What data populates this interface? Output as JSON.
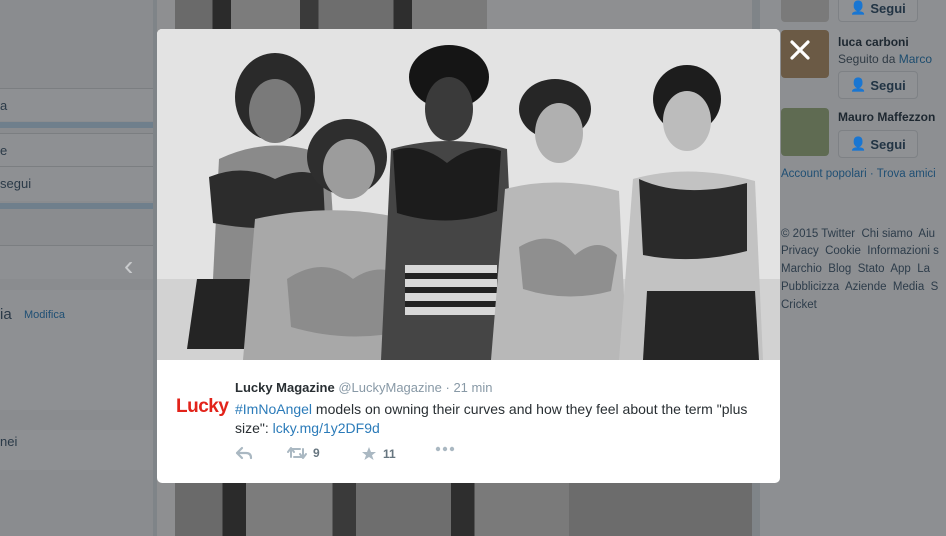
{
  "background": {
    "left_column": {
      "items": [
        "a",
        "e",
        "segui",
        "ia",
        "Modifica",
        "nei"
      ]
    },
    "who_to_follow": [
      {
        "name": "luca carboni",
        "subtitle_prefix": "Seguito da",
        "subtitle_link": "Marco",
        "button": "Segui"
      },
      {
        "name": "Mauro Maffezzon",
        "button": "Segui"
      }
    ],
    "top_button": "Segui",
    "links": [
      "Account popolari",
      "Trova amici"
    ],
    "footer": [
      "© 2015 Twitter",
      "Chi siamo",
      "Aiu",
      "Privacy",
      "Cookie",
      "Informazioni s",
      "Marchio",
      "Blog",
      "Stato",
      "App",
      "La",
      "Pubblicizza",
      "Aziende",
      "Media",
      "S",
      "Cricket"
    ]
  },
  "modal": {
    "close_icon": "close-icon",
    "tweet": {
      "avatar_logo": "Lucky",
      "name": "Lucky Magazine",
      "handle": "@LuckyMagazine",
      "separator": "·",
      "time": "21 min",
      "hashtag": "#ImNoAngel",
      "text": " models on owning their curves and how they feel about the term \"plus size\": ",
      "link": "lcky.mg/1y2DF9d",
      "actions": {
        "reply_icon": "reply-icon",
        "retweet_icon": "retweet-icon",
        "retweet_count": "9",
        "favorite_icon": "star-icon",
        "favorite_count": "11",
        "more_icon": "more-icon"
      }
    }
  },
  "colors": {
    "accent": "#2b7bb9",
    "logo_red": "#e2231a",
    "overlay": "#7f8488"
  }
}
